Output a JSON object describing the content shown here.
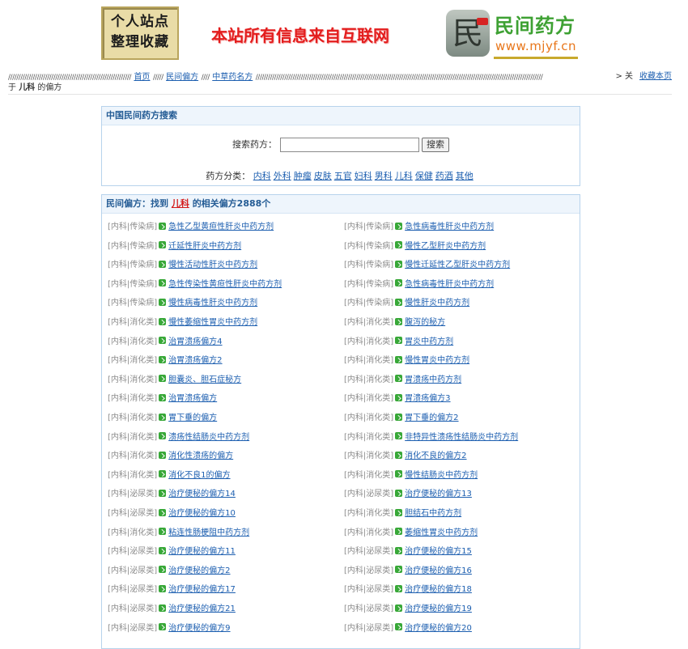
{
  "header": {
    "badge_line1": "个人站点",
    "badge_line2": "整理收藏",
    "slogan": "本站所有信息来自互联网",
    "seal_char": "民",
    "site_name": "民间药方",
    "site_url": "www.mjyf.cn"
  },
  "breadcrumb": {
    "slashes_a": "////////////////////////////////////////////////////////////",
    "home": "首页",
    "slashes_b": "/////",
    "folk": "民间偏方",
    "slashes_c": "////",
    "famous": "中草药名方",
    "slashes_d": "////////////////////////////////////////////////////////////////////////////////////////////////////////////////////////////////////////////",
    "about_prefix": "> 关",
    "about_suffix": "于",
    "keyword": "儿科",
    "of_folk": "的偏方",
    "favorite": "收藏本页"
  },
  "search": {
    "title": "中国民间药方搜索",
    "label": "搜索药方：",
    "input_value": "",
    "button": "搜索",
    "cat_label": "药方分类：",
    "categories": [
      "内科",
      "外科",
      "肿瘤",
      "皮肤",
      "五官",
      "妇科",
      "男科",
      "儿科",
      "保健",
      "药酒",
      "其他"
    ]
  },
  "results": {
    "title_prefix": "民间偏方：找到",
    "keyword": "儿科",
    "title_suffix": "的相关偏方2888个",
    "left": [
      {
        "cat": "[内科|传染病]",
        "name": "急性乙型黄疸性肝炎中药方剂"
      },
      {
        "cat": "[内科|传染病]",
        "name": "迁延性肝炎中药方剂"
      },
      {
        "cat": "[内科|传染病]",
        "name": "慢性活动性肝炎中药方剂"
      },
      {
        "cat": "[内科|传染病]",
        "name": "急性传染性黄疸性肝炎中药方剂"
      },
      {
        "cat": "[内科|传染病]",
        "name": "慢性病毒性肝炎中药方剂"
      },
      {
        "cat": "[内科|消化类]",
        "name": "慢性萎缩性胃炎中药方剂"
      },
      {
        "cat": "[内科|消化类]",
        "name": "治胃溃疡偏方4"
      },
      {
        "cat": "[内科|消化类]",
        "name": "治胃溃疡偏方2"
      },
      {
        "cat": "[内科|消化类]",
        "name": "胆囊炎、胆石症秘方"
      },
      {
        "cat": "[内科|消化类]",
        "name": "治胃溃疡偏方"
      },
      {
        "cat": "[内科|消化类]",
        "name": "胃下垂的偏方"
      },
      {
        "cat": "[内科|消化类]",
        "name": "溃疡性结肠炎中药方剂"
      },
      {
        "cat": "[内科|消化类]",
        "name": "消化性溃疡的偏方"
      },
      {
        "cat": "[内科|消化类]",
        "name": "消化不良1的偏方"
      },
      {
        "cat": "[内科|泌尿类]",
        "name": "治疗便秘的偏方14"
      },
      {
        "cat": "[内科|泌尿类]",
        "name": "治疗便秘的偏方10"
      },
      {
        "cat": "[内科|消化类]",
        "name": "粘连性肠梗阻中药方剂"
      },
      {
        "cat": "[内科|泌尿类]",
        "name": "治疗便秘的偏方11"
      },
      {
        "cat": "[内科|泌尿类]",
        "name": "治疗便秘的偏方2"
      },
      {
        "cat": "[内科|泌尿类]",
        "name": "治疗便秘的偏方17"
      },
      {
        "cat": "[内科|泌尿类]",
        "name": "治疗便秘的偏方21"
      },
      {
        "cat": "[内科|泌尿类]",
        "name": "治疗便秘的偏方9"
      }
    ],
    "right": [
      {
        "cat": "[内科|传染病]",
        "name": "急性病毒性肝炎中药方剂"
      },
      {
        "cat": "[内科|传染病]",
        "name": "慢性乙型肝炎中药方剂"
      },
      {
        "cat": "[内科|传染病]",
        "name": "慢性迁延性乙型肝炎中药方剂"
      },
      {
        "cat": "[内科|传染病]",
        "name": "急性病毒性肝炎中药方剂"
      },
      {
        "cat": "[内科|传染病]",
        "name": "慢性肝炎中药方剂"
      },
      {
        "cat": "[内科|消化类]",
        "name": "腹泻的秘方"
      },
      {
        "cat": "[内科|消化类]",
        "name": "胃炎中药方剂"
      },
      {
        "cat": "[内科|消化类]",
        "name": "慢性胃炎中药方剂"
      },
      {
        "cat": "[内科|消化类]",
        "name": "胃溃疡中药方剂"
      },
      {
        "cat": "[内科|消化类]",
        "name": "胃溃疡偏方3"
      },
      {
        "cat": "[内科|消化类]",
        "name": "胃下垂的偏方2"
      },
      {
        "cat": "[内科|消化类]",
        "name": "非特异性溃疡性结肠炎中药方剂"
      },
      {
        "cat": "[内科|消化类]",
        "name": "消化不良的偏方2"
      },
      {
        "cat": "[内科|消化类]",
        "name": "慢性结肠炎中药方剂"
      },
      {
        "cat": "[内科|泌尿类]",
        "name": "治疗便秘的偏方13"
      },
      {
        "cat": "[内科|消化类]",
        "name": "胆结石中药方剂"
      },
      {
        "cat": "[内科|消化类]",
        "name": "萎缩性胃炎中药方剂"
      },
      {
        "cat": "[内科|泌尿类]",
        "name": "治疗便秘的偏方15"
      },
      {
        "cat": "[内科|泌尿类]",
        "name": "治疗便秘的偏方16"
      },
      {
        "cat": "[内科|泌尿类]",
        "name": "治疗便秘的偏方18"
      },
      {
        "cat": "[内科|泌尿类]",
        "name": "治疗便秘的偏方19"
      },
      {
        "cat": "[内科|泌尿类]",
        "name": "治疗便秘的偏方20"
      }
    ]
  },
  "colors": {
    "link": "#1d5fb0",
    "slogan": "#e31d1d",
    "site_name": "#3ea133",
    "site_url": "#e8761a",
    "box_border": "#b7d3ec",
    "box_title_bg": "#eef5fc",
    "keyword": "#d41c1c"
  }
}
